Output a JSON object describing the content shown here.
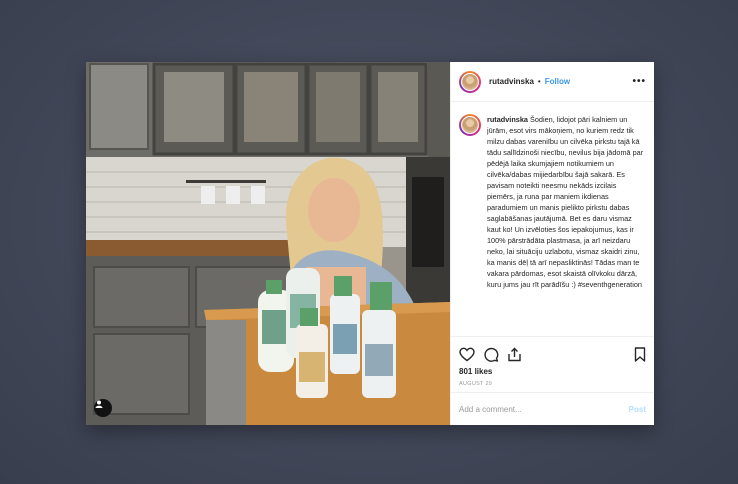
{
  "post": {
    "username": "rutadvinska",
    "separator": "•",
    "follow_label": "Follow",
    "more_glyph": "•••",
    "caption_username": "rutadvinska",
    "caption_text": "Šodien, lidojot pāri kalniem un jūrām, esot virs mākoņiem, no kuriem redz tik milzu dabas vareniību un cilvēka pirkstu tajā kā tādu sallīdzinoši niecību, nevilus bija jādomā par pēdējā laika skumjajiem notikumiem un cilvēka/dabas mijiedarbību šajā sakarā. Es pavisam noteikti neesmu nekāds izcilais piemērs, ja runa par maniem ikdienas paradumiem un manis pielikto pirkstu dabas saglabāšanas jautājumā. Bet es daru vismaz kaut ko! Un izvēloties šos iepakojumus, kas ir 100% pārstrādāta plastmasa, ja arī neizdaru neko, lai situāciju uzlabotu, vismaz skaidri zinu, ka manis dēļ tā arī nepasliktinās! Tādas man te vakara pārdomas, esot skaistā olīvkoku dārzā, kuru jums jau rīt parādīšu :) #seventhgeneration",
    "likes": "801 likes",
    "date": "AUGUST 29",
    "comment_placeholder": "Add a comment...",
    "post_label": "Post"
  },
  "icons": {
    "heart": "heart-icon",
    "comment": "comment-icon",
    "share": "share-icon",
    "bookmark": "bookmark-icon",
    "user_tag": "user-tag-icon"
  },
  "colors": {
    "link_blue": "#3897f0",
    "post_disabled": "#b2dffc",
    "text": "#262626",
    "background": "#434859"
  }
}
